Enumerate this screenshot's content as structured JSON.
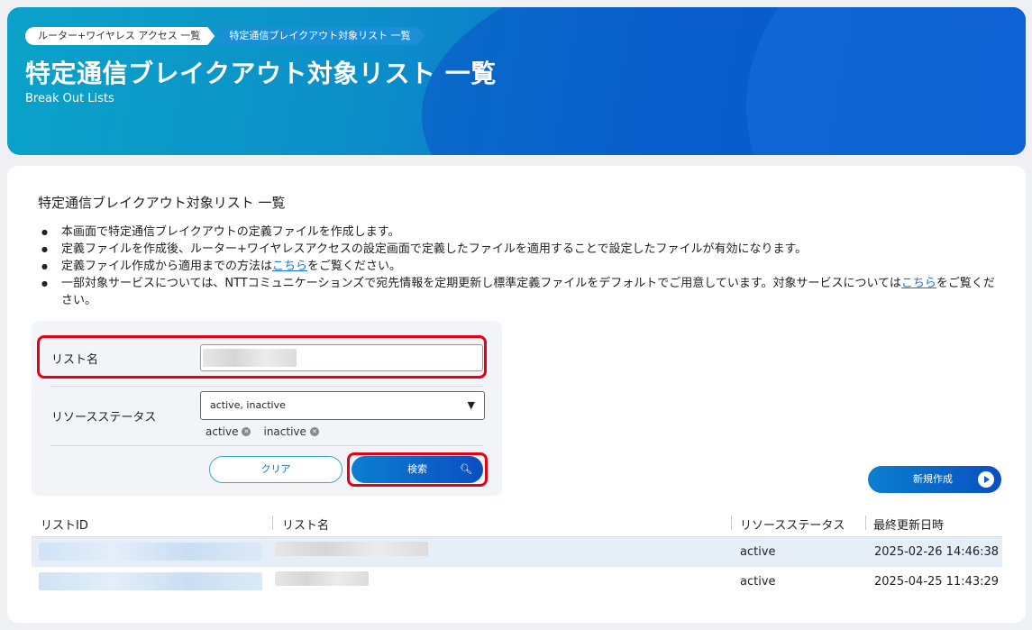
{
  "header": {
    "breadcrumb": [
      "ルーター+ワイヤレス アクセス 一覧",
      "特定通信ブレイクアウト対象リスト 一覧"
    ],
    "title": "特定通信ブレイクアウト対象リスト 一覧",
    "subtitle": "Break Out Lists"
  },
  "main": {
    "heading": "特定通信ブレイクアウト対象リスト 一覧",
    "notes": {
      "n1": "本画面で特定通信ブレイクアウトの定義ファイルを作成します。",
      "n2": "定義ファイルを作成後、ルーター+ワイヤレスアクセスの設定画面で定義したファイルを適用することで設定したファイルが有効になります。",
      "n3_before": "定義ファイル作成から適用までの方法は",
      "n3_link": "こちら",
      "n3_after": "をご覧ください。",
      "n4_before": "一部対象サービスについては、NTTコミュニケーションズで宛先情報を定期更新し標準定義ファイルをデフォルトでご用意しています。対象サービスについては",
      "n4_link": "こちら",
      "n4_after": "をご覧ください。"
    }
  },
  "search": {
    "list_name_label": "リスト名",
    "list_name_value": "",
    "status_label": "リソースステータス",
    "status_selected": "active, inactive",
    "chips": [
      "active",
      "inactive"
    ],
    "clear_label": "クリア",
    "search_label": "検索"
  },
  "actions": {
    "new_label": "新規作成"
  },
  "table": {
    "columns": [
      "リストID",
      "リスト名",
      "リソースステータス",
      "最終更新日時"
    ],
    "rows": [
      {
        "status": "active",
        "updated": "2025-02-26 14:46:38"
      },
      {
        "status": "active",
        "updated": "2025-04-25 11:43:29"
      }
    ]
  },
  "colors": {
    "accent": "#0a6fd0",
    "highlight": "#e60012",
    "link": "#1a73d9"
  }
}
